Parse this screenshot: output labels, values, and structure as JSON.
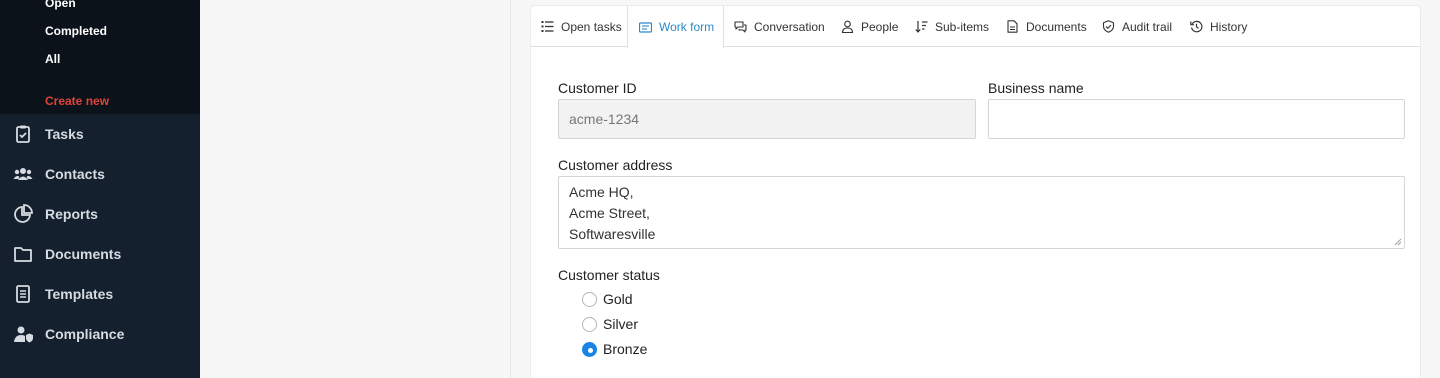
{
  "sidebar": {
    "submenu": [
      {
        "label": "Open"
      },
      {
        "label": "Completed"
      },
      {
        "label": "All"
      },
      {
        "label": "Create new"
      }
    ],
    "nav": [
      {
        "label": "Tasks",
        "icon": "clipboard-check-icon"
      },
      {
        "label": "Contacts",
        "icon": "users-icon"
      },
      {
        "label": "Reports",
        "icon": "pie-chart-icon"
      },
      {
        "label": "Documents",
        "icon": "folder-icon"
      },
      {
        "label": "Templates",
        "icon": "file-text-icon"
      },
      {
        "label": "Compliance",
        "icon": "user-shield-icon"
      }
    ]
  },
  "tabs": [
    {
      "label": "Open tasks",
      "icon": "task-list-icon"
    },
    {
      "label": "Work form",
      "icon": "form-icon",
      "active": true
    },
    {
      "label": "Conversation",
      "icon": "chat-icon"
    },
    {
      "label": "People",
      "icon": "person-icon"
    },
    {
      "label": "Sub-items",
      "icon": "sort-icon"
    },
    {
      "label": "Documents",
      "icon": "document-icon"
    },
    {
      "label": "Audit trail",
      "icon": "shield-icon"
    },
    {
      "label": "History",
      "icon": "history-icon"
    }
  ],
  "form": {
    "customer_id": {
      "label": "Customer ID",
      "value": "acme-1234"
    },
    "business_name": {
      "label": "Business name",
      "value": ""
    },
    "customer_address": {
      "label": "Customer address",
      "lines": [
        "Acme HQ,",
        "Acme Street,",
        "Softwaresville"
      ]
    },
    "customer_status": {
      "label": "Customer status",
      "options": [
        {
          "label": "Gold",
          "checked": false
        },
        {
          "label": "Silver",
          "checked": false
        },
        {
          "label": "Bronze",
          "checked": true
        }
      ]
    }
  },
  "colors": {
    "accent": "#2b8bc6",
    "danger": "#e0433a",
    "sidebar": "#14202e",
    "radio": "#1a84e6"
  }
}
